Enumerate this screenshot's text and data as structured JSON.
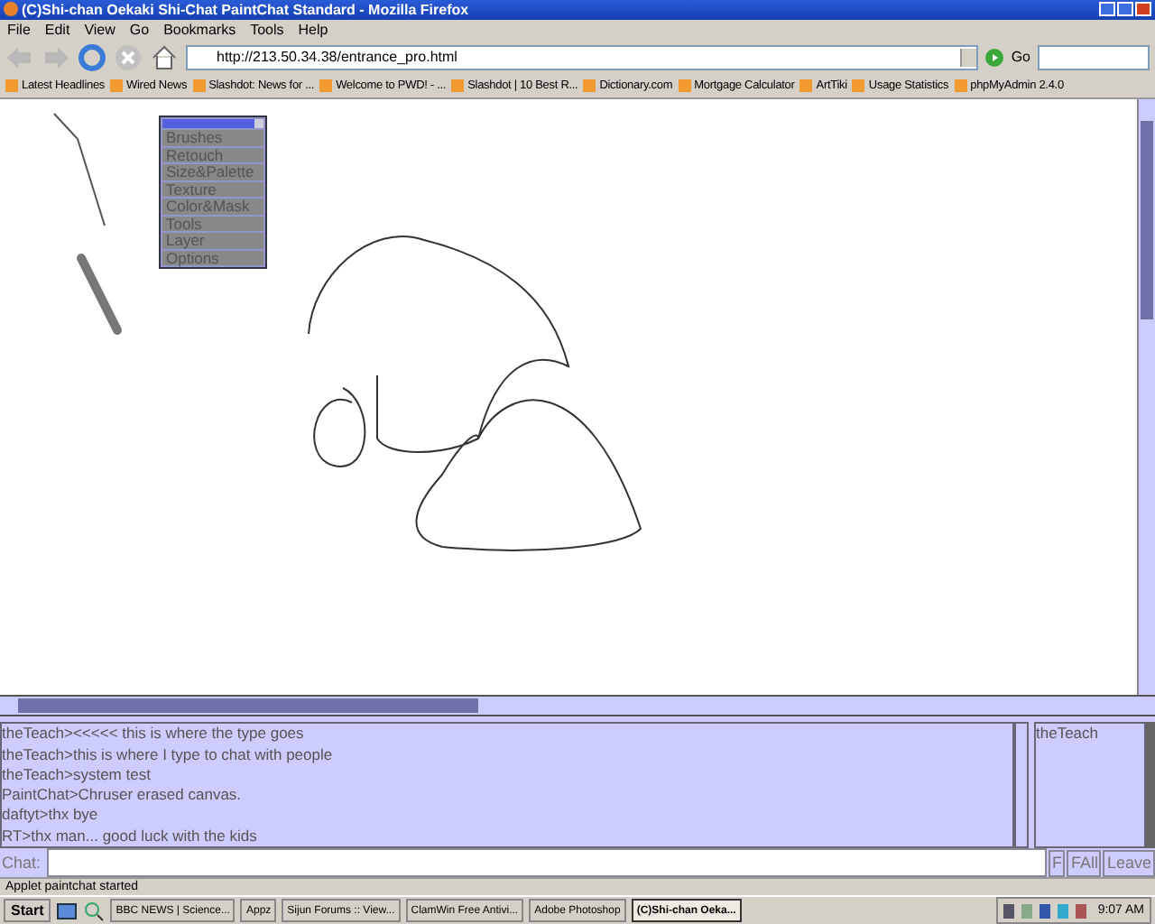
{
  "window": {
    "title": "(C)Shi-chan Oekaki Shi-Chat PaintChat Standard - Mozilla Firefox"
  },
  "menu": [
    "File",
    "Edit",
    "View",
    "Go",
    "Bookmarks",
    "Tools",
    "Help"
  ],
  "address": {
    "url": "http://213.50.34.38/entrance_pro.html",
    "go": "Go"
  },
  "bookmarks": [
    "Latest Headlines",
    "Wired News",
    "Slashdot: News for ...",
    "Welcome to PWD! - ...",
    "Slashdot | 10 Best R...",
    "Dictionary.com",
    "Mortgage Calculator",
    "ArtTiki",
    "Usage Statistics",
    "phpMyAdmin 2.4.0"
  ],
  "palette": {
    "items": [
      "Brushes",
      "Retouch",
      "Size&Palette",
      "Texture",
      "Color&Mask",
      "Tools",
      "Layer",
      "Options"
    ]
  },
  "chat": {
    "lines": [
      "theTeach><<<<< this is where the type goes",
      "theTeach>this is where I type to chat with people",
      "theTeach>system test",
      "PaintChat>Chruser erased canvas.",
      "daftyt>thx bye",
      "RT>thx man... good luck with the kids"
    ],
    "users": [
      "theTeach"
    ],
    "label": "Chat:",
    "buttons": [
      "F",
      "FAll",
      "Leave"
    ]
  },
  "status_bar": "Applet paintchat started",
  "taskbar": {
    "start": "Start",
    "tasks": [
      {
        "label": "BBC NEWS | Science...",
        "selected": false
      },
      {
        "label": "Appz",
        "selected": false
      },
      {
        "label": "Sijun Forums :: View...",
        "selected": false
      },
      {
        "label": "ClamWin Free Antivi...",
        "selected": false
      },
      {
        "label": "Adobe Photoshop",
        "selected": false
      },
      {
        "label": "(C)Shi-chan Oeka...",
        "selected": true
      }
    ],
    "clock": "9:07 AM"
  }
}
